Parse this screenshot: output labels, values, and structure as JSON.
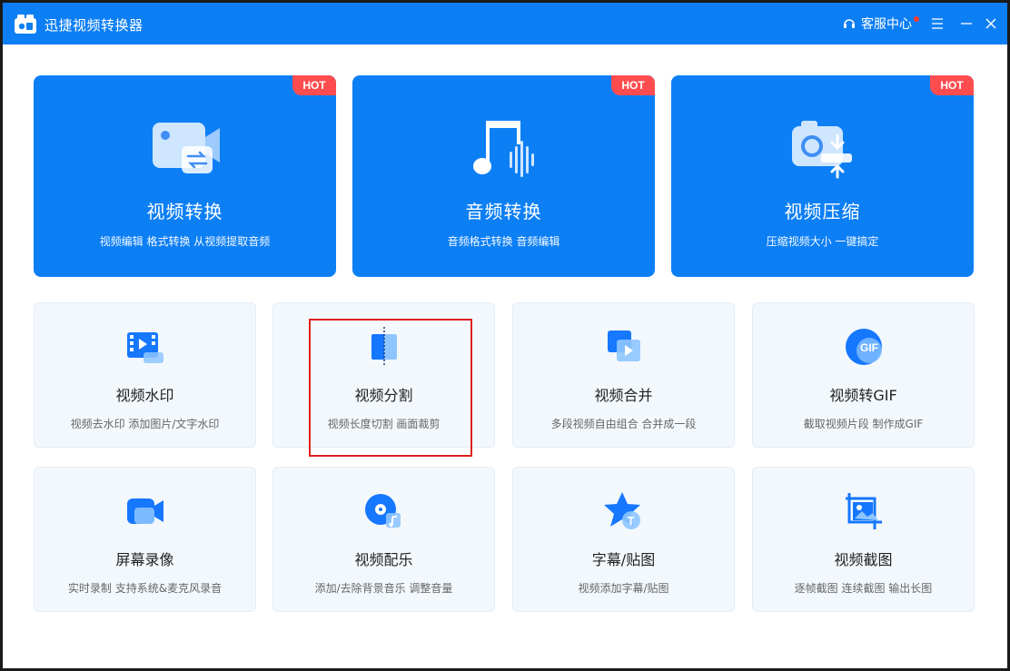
{
  "app": {
    "title": "迅捷视频转换器",
    "service_label": "客服中心",
    "accent_color": "#0d7ff5"
  },
  "big_cards": [
    {
      "title": "视频转换",
      "desc": "视频编辑 格式转换 从视频提取音频",
      "badge": "HOT",
      "icon": "video-convert-icon"
    },
    {
      "title": "音频转换",
      "desc": "音频格式转换 音频编辑",
      "badge": "HOT",
      "icon": "audio-convert-icon"
    },
    {
      "title": "视频压缩",
      "desc": "压缩视频大小 一键搞定",
      "badge": "HOT",
      "icon": "video-compress-icon"
    }
  ],
  "small_cards": [
    {
      "title": "视频水印",
      "desc": "视频去水印 添加图片/文字水印",
      "icon": "watermark-icon"
    },
    {
      "title": "视频分割",
      "desc": "视频长度切割 画面裁剪",
      "icon": "split-icon"
    },
    {
      "title": "视频合并",
      "desc": "多段视频自由组合 合并成一段",
      "icon": "merge-icon"
    },
    {
      "title": "视频转GIF",
      "desc": "截取视频片段 制作成GIF",
      "icon": "gif-icon",
      "icon_text": "GIF"
    },
    {
      "title": "屏幕录像",
      "desc": "实时录制 支持系统&麦克风录音",
      "icon": "screen-record-icon"
    },
    {
      "title": "视频配乐",
      "desc": "添加/去除背景音乐 调整音量",
      "icon": "music-icon"
    },
    {
      "title": "字幕/贴图",
      "desc": "视频添加字幕/贴图",
      "icon": "subtitle-icon",
      "icon_text": "T"
    },
    {
      "title": "视频截图",
      "desc": "逐帧截图 连续截图 输出长图",
      "icon": "screenshot-icon"
    }
  ]
}
